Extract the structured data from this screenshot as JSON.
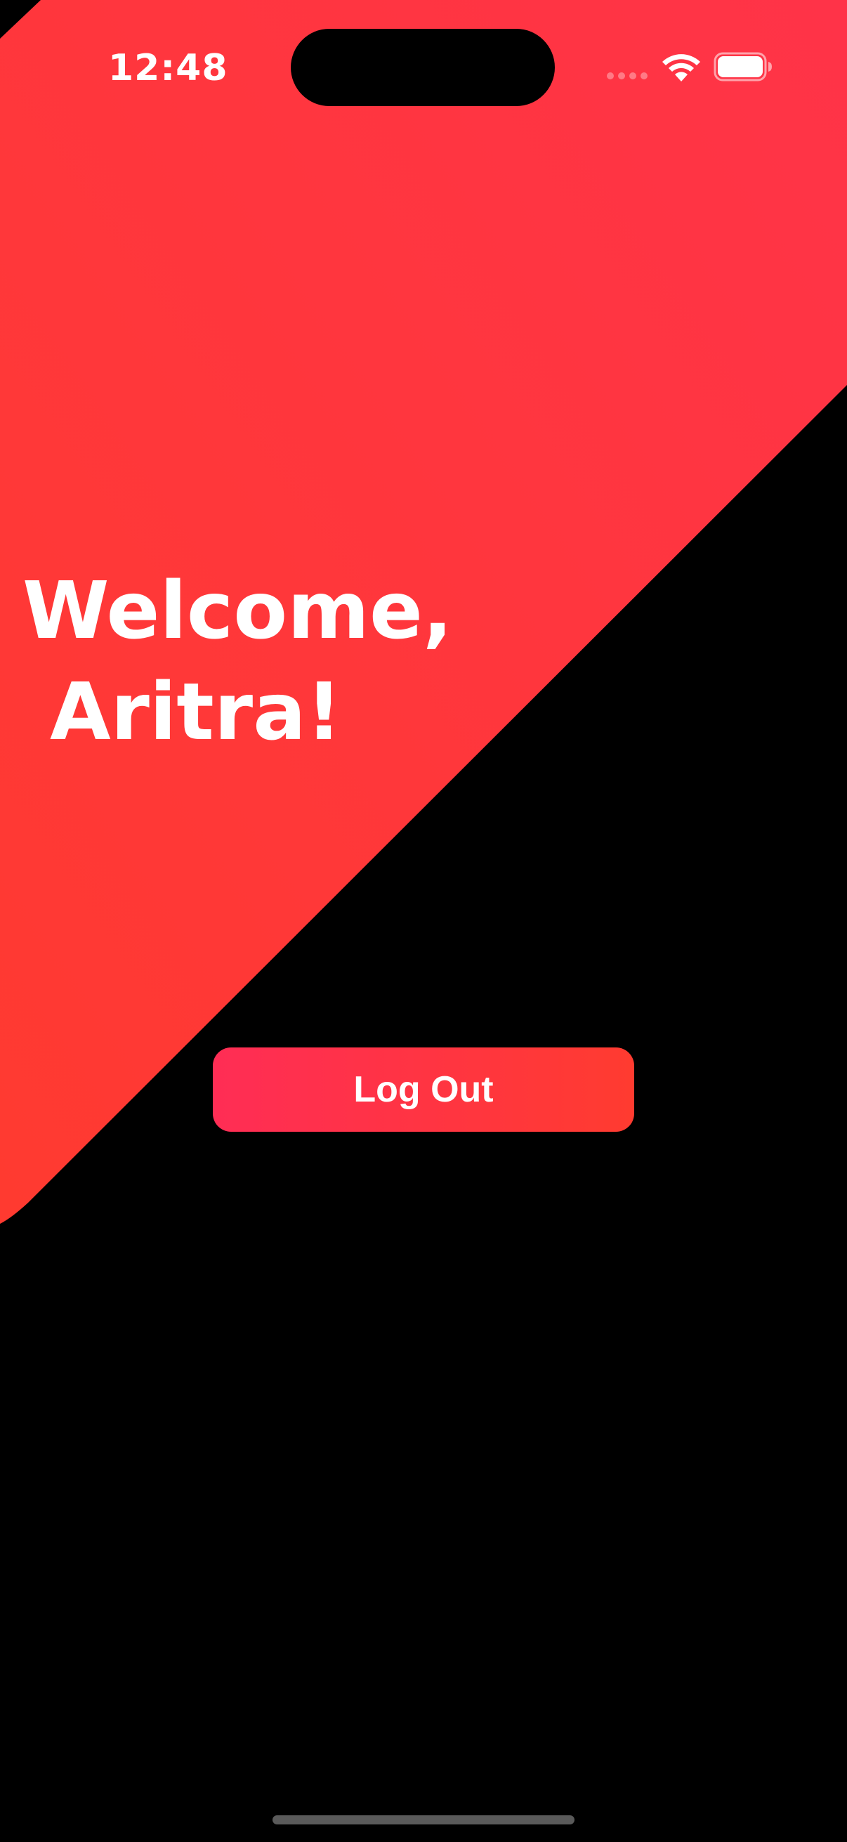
{
  "status_bar": {
    "time": "12:48"
  },
  "main": {
    "welcome_text": "Welcome,\n Aritra!",
    "logout_label": "Log Out"
  },
  "colors": {
    "accent_start": "#ff2d55",
    "accent_end": "#ff3b30",
    "shape_gradient": [
      "#ff3a30",
      "#ff3348"
    ],
    "background": "#000000"
  },
  "icons": {
    "wifi": "wifi-icon",
    "battery": "battery-icon",
    "cellular": "cellular-dots-icon"
  }
}
